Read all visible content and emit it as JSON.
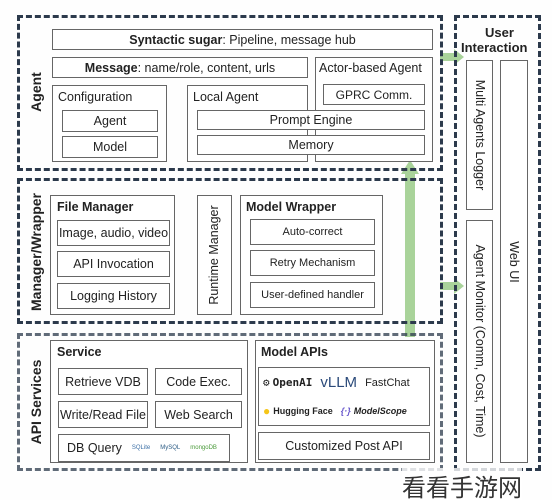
{
  "agent": {
    "label": "Agent",
    "syntactic_sugar": {
      "bold": "Syntactic sugar",
      "rest": ": Pipeline, message hub"
    },
    "message": {
      "bold": "Message",
      "rest": ": name/role, content, urls"
    },
    "actor_based_agent": "Actor-based Agent",
    "gprc": "GPRC Comm.",
    "configuration": {
      "title": "Configuration",
      "items": [
        "Agent",
        "Model"
      ]
    },
    "local_agent": "Local Agent",
    "prompt_engine": "Prompt Engine",
    "memory": "Memory"
  },
  "manager_wrapper": {
    "label": "Manager/Wrapper",
    "file_manager": {
      "title": "File Manager",
      "items": [
        "Image, audio, video",
        "API Invocation",
        "Logging History"
      ]
    },
    "runtime_manager": "Runtime Manager",
    "model_wrapper": {
      "title": "Model Wrapper",
      "items": [
        "Auto-correct",
        "Retry Mechanism",
        "User-defined handler"
      ]
    }
  },
  "api_services": {
    "label": "API Services",
    "service": {
      "title": "Service",
      "items": [
        "Retrieve VDB",
        "Code Exec.",
        "Write/Read File",
        "Web Search"
      ],
      "db_query": "DB Query",
      "db_logos": [
        "SQLite",
        "MySQL",
        "mongoDB"
      ]
    },
    "model_apis": {
      "title": "Model APIs",
      "logos": [
        "OpenAI",
        "vLLM",
        "FastChat",
        "Hugging Face",
        "ModelScope"
      ],
      "custom": "Customized Post API"
    }
  },
  "user_interaction": {
    "title_line1": "User",
    "title_line2": "Interaction",
    "logger": "Multi Agents Logger",
    "monitor": "Agent Monitor (Comm, Cost, Time)",
    "web_ui": "Web UI"
  },
  "watermark": "看看手游网",
  "colors": {
    "dash": "#2c3a4c",
    "arrow": "#a9d39a"
  }
}
